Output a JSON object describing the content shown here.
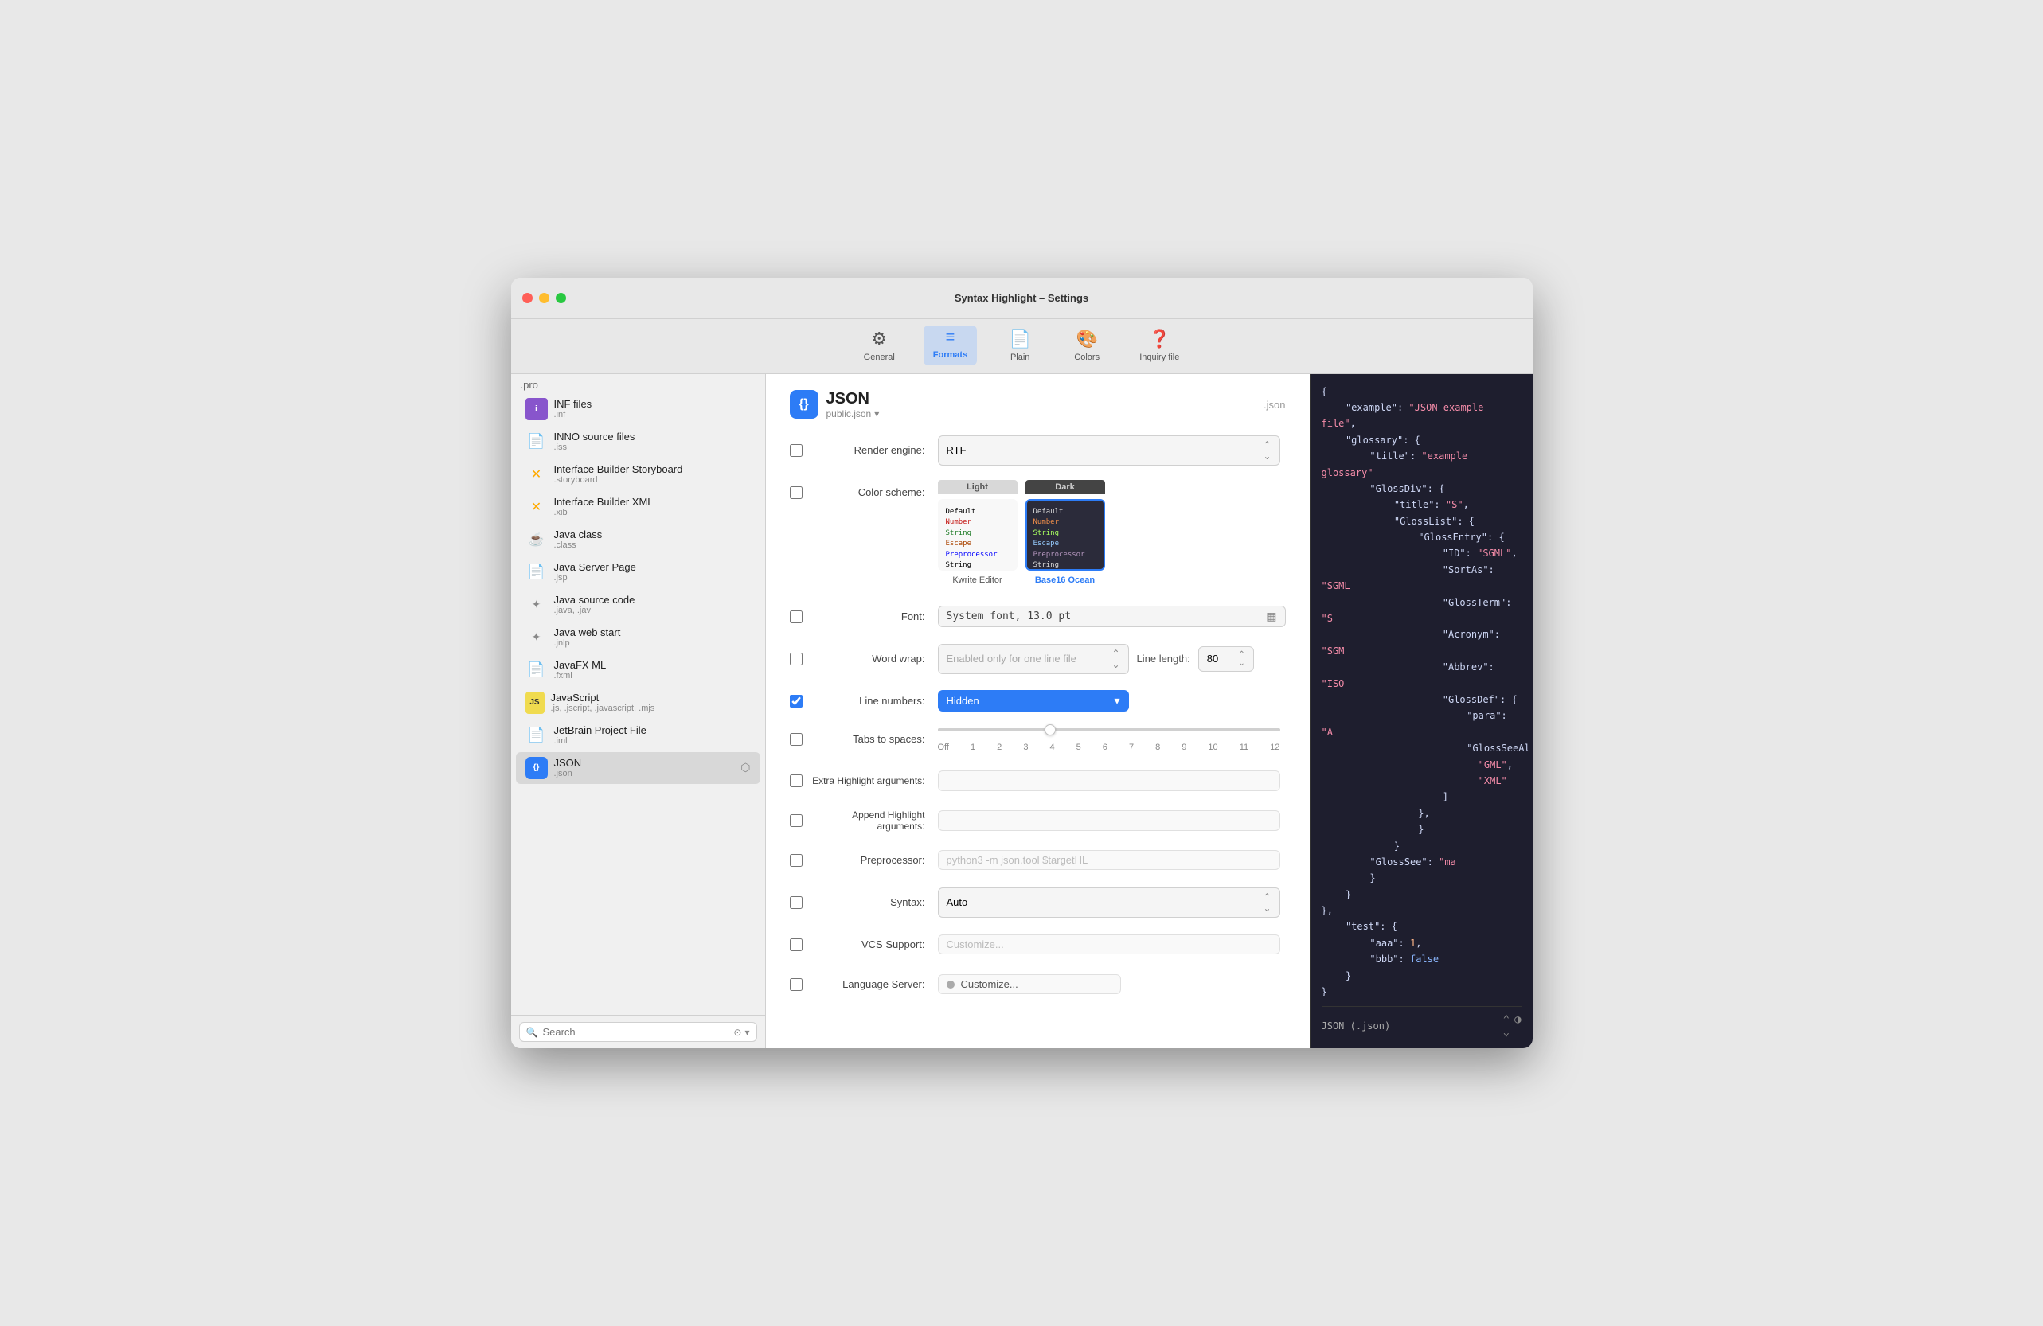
{
  "window": {
    "title": "Syntax Highlight – Settings"
  },
  "toolbar": {
    "items": [
      {
        "id": "general",
        "label": "General",
        "icon": "⚙",
        "active": false
      },
      {
        "id": "formats",
        "label": "Formats",
        "icon": "≡",
        "active": true
      },
      {
        "id": "plain",
        "label": "Plain",
        "icon": "📄",
        "active": false
      },
      {
        "id": "colors",
        "label": "Colors",
        "icon": "🎨",
        "active": false
      },
      {
        "id": "inquiry",
        "label": "Inquiry file",
        "icon": "❓",
        "active": false
      }
    ]
  },
  "sidebar": {
    "pro_label": ".pro",
    "items": [
      {
        "id": "inf-files",
        "name": "INF files",
        "ext": ".inf",
        "icon_color": "#8855cc",
        "icon_char": "i",
        "active": false
      },
      {
        "id": "inno-source",
        "name": "INNO source files",
        "ext": ".iss",
        "icon_color": "#888",
        "icon_char": "📄",
        "active": false
      },
      {
        "id": "ib-storyboard",
        "name": "Interface Builder Storyboard",
        "ext": ".storyboard",
        "icon_color": "#ffaa00",
        "icon_char": "✕",
        "active": false
      },
      {
        "id": "ib-xml",
        "name": "Interface Builder XML",
        "ext": ".xib",
        "icon_color": "#ffaa00",
        "icon_char": "✕",
        "active": false
      },
      {
        "id": "java-class",
        "name": "Java class",
        "ext": ".class",
        "icon_color": "#888",
        "icon_char": "☕",
        "active": false
      },
      {
        "id": "java-server",
        "name": "Java Server Page",
        "ext": ".jsp",
        "icon_color": "#888",
        "icon_char": "📄",
        "active": false
      },
      {
        "id": "java-source",
        "name": "Java source code",
        "ext": ".java, .jav",
        "icon_color": "#888",
        "icon_char": "✦",
        "active": false
      },
      {
        "id": "java-web",
        "name": "Java web start",
        "ext": ".jnlp",
        "icon_color": "#888",
        "icon_char": "✦",
        "active": false
      },
      {
        "id": "javafx-ml",
        "name": "JavaFX ML",
        "ext": ".fxml",
        "icon_color": "#888",
        "icon_char": "📄",
        "active": false
      },
      {
        "id": "javascript",
        "name": "JavaScript",
        "ext": ".js, .jscript, .javascript, .mjs",
        "icon_color": "#888",
        "icon_char": "JS",
        "active": false
      },
      {
        "id": "jetbrain",
        "name": "JetBrain Project File",
        "ext": ".iml",
        "icon_color": "#888",
        "icon_char": "📄",
        "active": false
      },
      {
        "id": "json",
        "name": "JSON",
        "ext": ".json",
        "icon_color": "#2d7cf6",
        "icon_char": "{}",
        "active": true
      }
    ],
    "search_placeholder": "Search"
  },
  "format": {
    "icon_char": "{}",
    "title": "JSON",
    "subtitle": "public.json",
    "ext_label": ".json",
    "rows": {
      "render_engine": {
        "label": "Render engine:",
        "value": "RTF",
        "checkbox": false
      },
      "color_scheme": {
        "label": "Color scheme:",
        "checkbox": false,
        "light_label": "Kwrite Editor",
        "dark_label": "Base16 Ocean",
        "dark_selected": true
      },
      "font": {
        "label": "Font:",
        "value": "System font, 13.0 pt",
        "checkbox": false
      },
      "word_wrap": {
        "label": "Word wrap:",
        "value": "Enabled only for one line file",
        "line_length_label": "Line length:",
        "line_length_value": "80",
        "checkbox": false
      },
      "line_numbers": {
        "label": "Line numbers:",
        "value": "Hidden",
        "checkbox": true,
        "checked": true
      },
      "tabs_to_spaces": {
        "label": "Tabs to spaces:",
        "checkbox": false,
        "slider_labels": [
          "Off",
          "1",
          "2",
          "3",
          "4",
          "5",
          "6",
          "7",
          "8",
          "9",
          "10",
          "11",
          "12"
        ]
      },
      "extra_highlight": {
        "label": "Extra Highlight arguments:",
        "value": "",
        "checkbox": false
      },
      "append_highlight": {
        "label": "Append Highlight arguments:",
        "value": "",
        "checkbox": false
      },
      "preprocessor": {
        "label": "Preprocessor:",
        "value": "python3 -m json.tool $targetHL",
        "checkbox": false
      },
      "syntax": {
        "label": "Syntax:",
        "value": "Auto",
        "checkbox": false
      },
      "vcs_support": {
        "label": "VCS Support:",
        "value": "Customize...",
        "checkbox": false
      },
      "language_server": {
        "label": "Language Server:",
        "value": "Customize...",
        "checkbox": false
      }
    }
  },
  "code_preview": {
    "lines": [
      {
        "indent": 0,
        "text": "{"
      },
      {
        "indent": 1,
        "type": "key-str",
        "key": "\"example\"",
        "val": "\"JSON example file\","
      },
      {
        "indent": 1,
        "type": "key-obj",
        "key": "\"glossary\"",
        "val": "{"
      },
      {
        "indent": 2,
        "type": "key-str",
        "key": "\"title\"",
        "val": "\"example glossary\""
      },
      {
        "indent": 2,
        "type": "key-obj",
        "key": "\"GlossDiv\"",
        "val": "{"
      },
      {
        "indent": 3,
        "type": "key-str",
        "key": "\"title\"",
        "val": "\"S\","
      },
      {
        "indent": 3,
        "type": "key-obj",
        "key": "\"GlossList\"",
        "val": "{"
      },
      {
        "indent": 4,
        "type": "key-obj",
        "key": "\"GlossEntry\"",
        "val": "{"
      },
      {
        "indent": 5,
        "type": "key-str",
        "key": "\"ID\"",
        "val": "\"SGML\","
      },
      {
        "indent": 5,
        "type": "key-str",
        "key": "\"SortAs\"",
        "val": "\"SGML\""
      },
      {
        "indent": 5,
        "type": "key-str",
        "key": "\"GlossTerm\"",
        "val": "\"S..."
      },
      {
        "indent": 5,
        "type": "key-str",
        "key": "\"Acronym\"",
        "val": "\"SGM..."
      },
      {
        "indent": 5,
        "type": "key-str",
        "key": "\"Abbrev\"",
        "val": "\"ISO..."
      },
      {
        "indent": 5,
        "type": "key-obj",
        "key": "\"GlossDef\"",
        "val": "{"
      },
      {
        "indent": 6,
        "type": "key-str",
        "key": "\"para\"",
        "val": "\"A..."
      },
      {
        "indent": 6,
        "type": "key-arr",
        "key": "\"GlossSeeAl",
        "val": ""
      },
      {
        "indent": 6,
        "type": "plain",
        "val": "\"GML\","
      },
      {
        "indent": 6,
        "type": "plain",
        "val": "\"XML\""
      },
      {
        "indent": 5,
        "type": "close-bracket",
        "val": "]"
      },
      {
        "indent": 4,
        "type": "close-brace",
        "val": "},"
      },
      {
        "indent": 4,
        "type": "close-brace",
        "val": "}"
      },
      {
        "indent": 3,
        "type": "close-brace",
        "val": "}"
      },
      {
        "indent": 2,
        "type": "key-str",
        "key": "\"GlossSee\"",
        "val": "\"ma..."
      },
      {
        "indent": 2,
        "type": "close-brace",
        "val": "}"
      },
      {
        "indent": 1,
        "type": "close-brace",
        "val": "}"
      },
      {
        "indent": 0,
        "type": "close-brace",
        "val": "},"
      },
      {
        "indent": 1,
        "type": "key-obj",
        "key": "\"test\"",
        "val": "{"
      },
      {
        "indent": 2,
        "type": "key-num",
        "key": "\"aaa\"",
        "val": "1,"
      },
      {
        "indent": 2,
        "type": "key-bool",
        "key": "\"bbb\"",
        "val": "false"
      },
      {
        "indent": 1,
        "type": "close-brace",
        "val": "}"
      },
      {
        "indent": 0,
        "type": "close-brace",
        "val": "}"
      }
    ],
    "bottom_label": "JSON (.json)"
  }
}
